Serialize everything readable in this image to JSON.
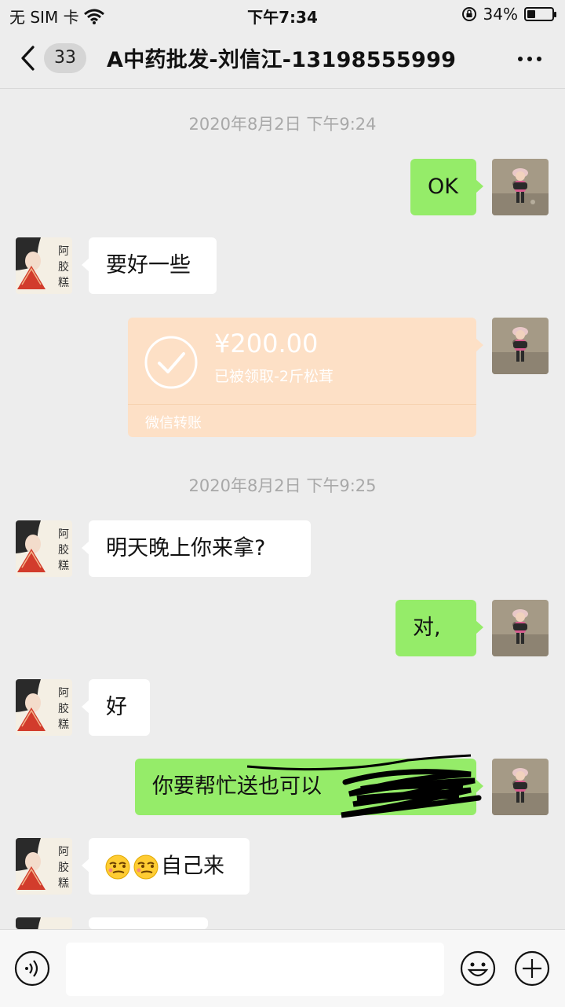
{
  "status_bar": {
    "carrier": "无 SIM 卡",
    "time": "下午7:34",
    "battery_percent": "34%",
    "battery_level": 0.34
  },
  "header": {
    "unread_count": "33",
    "title": "A中药批发-刘信江-13198555999"
  },
  "timestamps": [
    "2020年8月2日 下午9:24",
    "2020年8月2日 下午9:25"
  ],
  "messages": [
    {
      "side": "right",
      "text": "OK"
    },
    {
      "side": "left",
      "text": "要好一些"
    },
    {
      "side": "right",
      "type": "transfer",
      "amount": "¥200.00",
      "note": "已被领取-2斤松茸",
      "footer": "微信转账"
    },
    {
      "side": "left",
      "text": "明天晚上你来拿?"
    },
    {
      "side": "right",
      "text": "对,"
    },
    {
      "side": "left",
      "text": "好"
    },
    {
      "side": "right",
      "text": "你要帮忙送也可以"
    },
    {
      "side": "left",
      "text": "自己来",
      "emoji": [
        "smirk-emoji",
        "smirk-emoji"
      ]
    }
  ],
  "input": {
    "placeholder": ""
  },
  "colors": {
    "background": "#ededed",
    "bubble_mine": "#95ec69",
    "bubble_theirs": "#ffffff",
    "transfer_card": "#fde0c6"
  },
  "icons": [
    "back-icon",
    "more-icon",
    "check-icon",
    "voice-icon",
    "emoji-icon",
    "plus-icon",
    "wifi-icon",
    "lock-rotation-icon"
  ]
}
